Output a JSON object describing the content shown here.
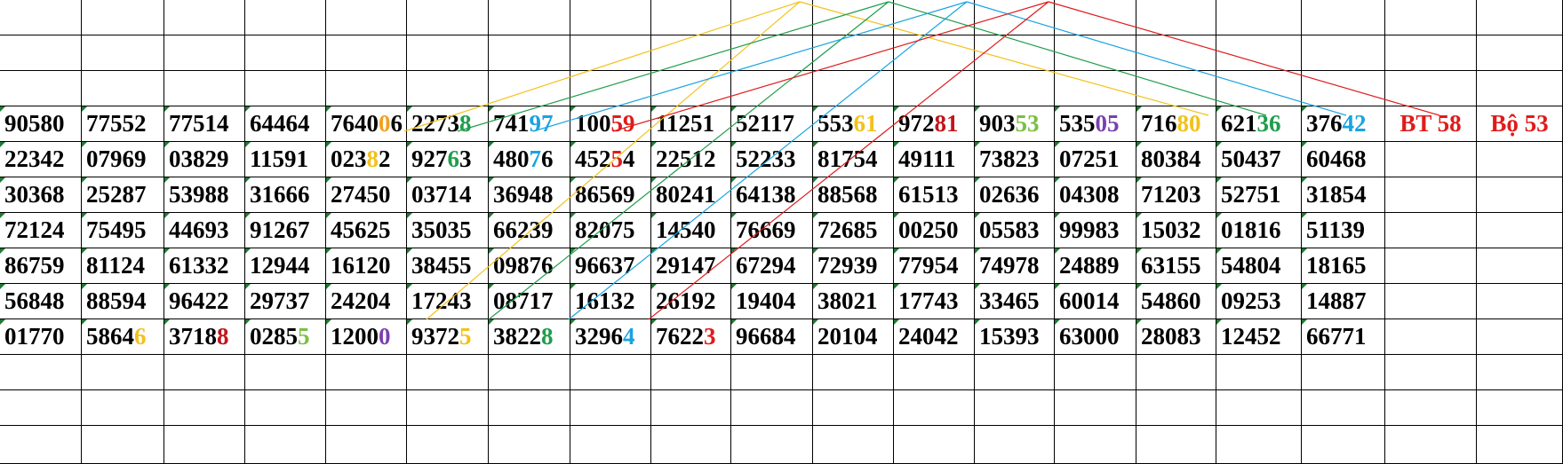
{
  "colors": {
    "yellow": "#f2c21a",
    "green": "#1f9e4a",
    "blue": "#1aa3e0",
    "red": "#e01b1b",
    "purple": "#7a3fb0",
    "lightgreen": "#7ac043",
    "darkred": "#c0161c",
    "orange": "#f0a020"
  },
  "extra": {
    "bt": "BT 58",
    "bo": "Bộ 53"
  },
  "rows": [
    [
      [
        {
          "t": "90580"
        }
      ],
      [
        {
          "t": "77552"
        }
      ],
      [
        {
          "t": "77514"
        }
      ],
      [
        {
          "t": "64464"
        }
      ],
      [
        {
          "t": "7640"
        },
        {
          "t": "0",
          "c": "orange"
        },
        {
          "t": "6"
        }
      ],
      [
        {
          "t": "2273"
        },
        {
          "t": "8",
          "c": "green"
        }
      ],
      [
        {
          "t": "741"
        },
        {
          "t": "97",
          "c": "blue"
        }
      ],
      [
        {
          "t": "100"
        },
        {
          "t": "59",
          "c": "red"
        }
      ],
      [
        {
          "t": "11251"
        }
      ],
      [
        {
          "t": "52117"
        }
      ],
      [
        {
          "t": "553"
        },
        {
          "t": "61",
          "c": "yellow"
        }
      ],
      [
        {
          "t": "972"
        },
        {
          "t": "81",
          "c": "darkred"
        }
      ],
      [
        {
          "t": "903"
        },
        {
          "t": "53",
          "c": "lightgreen"
        }
      ],
      [
        {
          "t": "535"
        },
        {
          "t": "05",
          "c": "purple"
        }
      ],
      [
        {
          "t": "716"
        },
        {
          "t": "80",
          "c": "yellow"
        }
      ],
      [
        {
          "t": "621"
        },
        {
          "t": "36",
          "c": "green"
        }
      ],
      [
        {
          "t": "376"
        },
        {
          "t": "42",
          "c": "blue"
        }
      ]
    ],
    [
      [
        {
          "t": "22342"
        }
      ],
      [
        {
          "t": "07969"
        }
      ],
      [
        {
          "t": "03829"
        }
      ],
      [
        {
          "t": "11591"
        }
      ],
      [
        {
          "t": "023"
        },
        {
          "t": "8",
          "c": "yellow"
        },
        {
          "t": "2"
        }
      ],
      [
        {
          "t": "927"
        },
        {
          "t": "6",
          "c": "green"
        },
        {
          "t": "3"
        }
      ],
      [
        {
          "t": "480"
        },
        {
          "t": "7",
          "c": "blue"
        },
        {
          "t": "6"
        }
      ],
      [
        {
          "t": "452"
        },
        {
          "t": "5",
          "c": "red"
        },
        {
          "t": "4"
        }
      ],
      [
        {
          "t": "22512"
        }
      ],
      [
        {
          "t": "52233"
        }
      ],
      [
        {
          "t": "81754"
        }
      ],
      [
        {
          "t": "49111"
        }
      ],
      [
        {
          "t": "73823"
        }
      ],
      [
        {
          "t": "07251"
        }
      ],
      [
        {
          "t": "80384"
        }
      ],
      [
        {
          "t": "50437"
        }
      ],
      [
        {
          "t": "60468"
        }
      ]
    ],
    [
      [
        {
          "t": "30368"
        }
      ],
      [
        {
          "t": "25287"
        }
      ],
      [
        {
          "t": "53988"
        }
      ],
      [
        {
          "t": "31666"
        }
      ],
      [
        {
          "t": "27450"
        }
      ],
      [
        {
          "t": "03714"
        }
      ],
      [
        {
          "t": "36948"
        }
      ],
      [
        {
          "t": "86569"
        }
      ],
      [
        {
          "t": "80241"
        }
      ],
      [
        {
          "t": "64138"
        }
      ],
      [
        {
          "t": "88568"
        }
      ],
      [
        {
          "t": "61513"
        }
      ],
      [
        {
          "t": "02636"
        }
      ],
      [
        {
          "t": "04308"
        }
      ],
      [
        {
          "t": "71203"
        }
      ],
      [
        {
          "t": "52751"
        }
      ],
      [
        {
          "t": "31854"
        }
      ]
    ],
    [
      [
        {
          "t": "72124"
        }
      ],
      [
        {
          "t": "75495"
        }
      ],
      [
        {
          "t": "44693"
        }
      ],
      [
        {
          "t": "91267"
        }
      ],
      [
        {
          "t": "45625"
        }
      ],
      [
        {
          "t": "35035"
        }
      ],
      [
        {
          "t": "66239"
        }
      ],
      [
        {
          "t": "82075"
        }
      ],
      [
        {
          "t": "14540"
        }
      ],
      [
        {
          "t": "76669"
        }
      ],
      [
        {
          "t": "72685"
        }
      ],
      [
        {
          "t": "00250"
        }
      ],
      [
        {
          "t": "05583"
        }
      ],
      [
        {
          "t": "99983"
        }
      ],
      [
        {
          "t": "15032"
        }
      ],
      [
        {
          "t": "01816"
        }
      ],
      [
        {
          "t": "51139"
        }
      ]
    ],
    [
      [
        {
          "t": "86759"
        }
      ],
      [
        {
          "t": "81124"
        }
      ],
      [
        {
          "t": "61332"
        }
      ],
      [
        {
          "t": "12944"
        }
      ],
      [
        {
          "t": "16120"
        }
      ],
      [
        {
          "t": "38455"
        }
      ],
      [
        {
          "t": "09876"
        }
      ],
      [
        {
          "t": "96637"
        }
      ],
      [
        {
          "t": "29147"
        }
      ],
      [
        {
          "t": "67294"
        }
      ],
      [
        {
          "t": "72939"
        }
      ],
      [
        {
          "t": "77954"
        }
      ],
      [
        {
          "t": "74978"
        }
      ],
      [
        {
          "t": "24889"
        }
      ],
      [
        {
          "t": "63155"
        }
      ],
      [
        {
          "t": "54804"
        }
      ],
      [
        {
          "t": "18165"
        }
      ]
    ],
    [
      [
        {
          "t": "56848"
        }
      ],
      [
        {
          "t": "88594"
        }
      ],
      [
        {
          "t": "96422"
        }
      ],
      [
        {
          "t": "29737"
        }
      ],
      [
        {
          "t": "24204"
        }
      ],
      [
        {
          "t": "17243"
        }
      ],
      [
        {
          "t": "08717"
        }
      ],
      [
        {
          "t": "16132"
        }
      ],
      [
        {
          "t": "26192"
        }
      ],
      [
        {
          "t": "19404"
        }
      ],
      [
        {
          "t": "38021"
        }
      ],
      [
        {
          "t": "17743"
        }
      ],
      [
        {
          "t": "33465"
        }
      ],
      [
        {
          "t": "60014"
        }
      ],
      [
        {
          "t": "54860"
        }
      ],
      [
        {
          "t": "09253"
        }
      ],
      [
        {
          "t": "14887"
        }
      ]
    ],
    [
      [
        {
          "t": "01770"
        }
      ],
      [
        {
          "t": "5864"
        },
        {
          "t": "6",
          "c": "yellow"
        }
      ],
      [
        {
          "t": "3718"
        },
        {
          "t": "8",
          "c": "darkred"
        }
      ],
      [
        {
          "t": "0285"
        },
        {
          "t": "5",
          "c": "lightgreen"
        }
      ],
      [
        {
          "t": "1200"
        },
        {
          "t": "0",
          "c": "purple"
        }
      ],
      [
        {
          "t": "9372"
        },
        {
          "t": "5",
          "c": "yellow"
        }
      ],
      [
        {
          "t": "3822"
        },
        {
          "t": "8",
          "c": "green"
        }
      ],
      [
        {
          "t": "3296"
        },
        {
          "t": "4",
          "c": "blue"
        }
      ],
      [
        {
          "t": "7622"
        },
        {
          "t": "3",
          "c": "red"
        }
      ],
      [
        {
          "t": "96684"
        }
      ],
      [
        {
          "t": "20104"
        }
      ],
      [
        {
          "t": "24042"
        }
      ],
      [
        {
          "t": "15393"
        }
      ],
      [
        {
          "t": "63000"
        }
      ],
      [
        {
          "t": "28083"
        }
      ],
      [
        {
          "t": "12452"
        }
      ],
      [
        {
          "t": "66771"
        }
      ]
    ]
  ]
}
